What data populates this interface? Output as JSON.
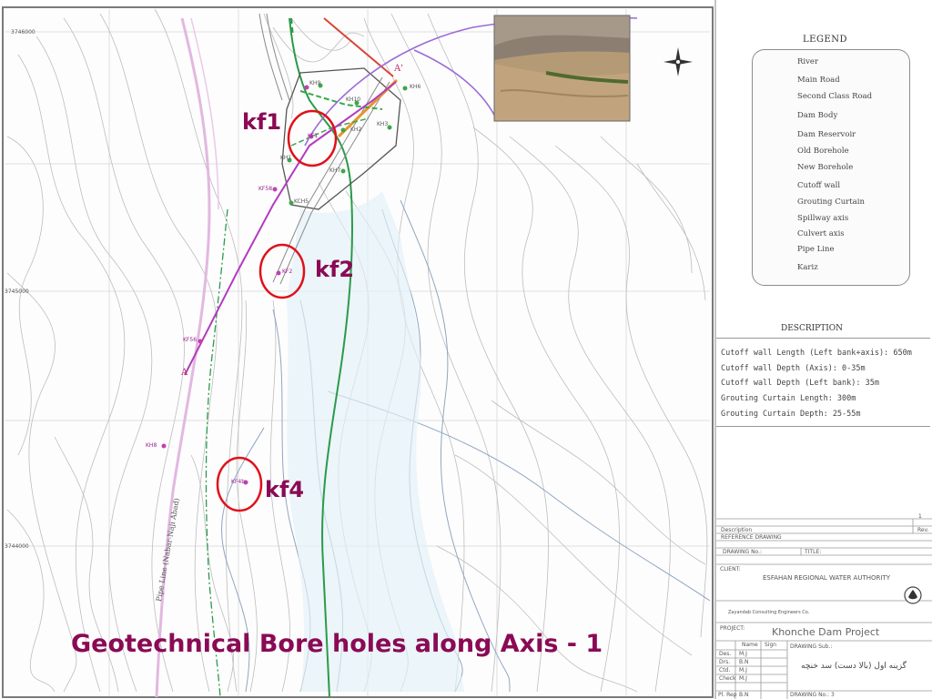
{
  "legend": {
    "title": "LEGEND",
    "items": [
      {
        "label": "River",
        "symbol": "river-line",
        "color": "#6a8fb0"
      },
      {
        "label": "Main Road",
        "symbol": "double-line",
        "color": "#888888"
      },
      {
        "label": "Second Class Road",
        "symbol": "double-line-thin",
        "color": "#aaaaaa"
      },
      {
        "label": "Dam Body",
        "symbol": "dam-outline",
        "color": "#333333"
      },
      {
        "label": "Dam Reservoir",
        "symbol": "hatched-box",
        "color": "#9cc9dd"
      },
      {
        "label": "Old Borehole",
        "symbol": "green-dot",
        "color": "#3aa84a"
      },
      {
        "label": "New Borehole",
        "symbol": "pink-dot",
        "color": "#c040b0"
      },
      {
        "label": "Cutoff wall",
        "symbol": "line",
        "color": "#b23bc0"
      },
      {
        "label": "Grouting Curtain",
        "symbol": "line",
        "color": "#e8952a"
      },
      {
        "label": "Spillway axis",
        "symbol": "line",
        "color": "#d9443a"
      },
      {
        "label": "Culvert axis",
        "symbol": "dash-line",
        "color": "#3aa84a"
      },
      {
        "label": "Pipe Line",
        "symbol": "thick-line",
        "color": "#e2b8e0"
      },
      {
        "label": "Kariz",
        "symbol": "dot-line",
        "color": "#3aa890"
      }
    ]
  },
  "description": {
    "title": "DESCRIPTION",
    "lines": [
      "Cutoff wall Length (Left bank+axis): 650m",
      "Cutoff wall Depth (Axis): 0-35m",
      "Cutoff wall Depth (Left bank): 35m",
      "Grouting Curtain Length: 300m",
      "Grouting Curtain Depth: 25-55m"
    ]
  },
  "title_block": {
    "description_label": "Description",
    "rev_label": "Rev.",
    "rev_value": "1",
    "reference_drawing": "REFERENCE DRAWING",
    "drawing_no": "DRAWING No.:",
    "title_label": "TITLE:",
    "client_label": "CLIENT:",
    "client_name": "ESFAHAN REGIONAL WATER AUTHORITY",
    "consultant": "Zayandab Consulting Engineers Co.",
    "project_label": "PROJECT:",
    "project_name": "Khonche Dam Project",
    "drawing_sub": "DRAWING Sub.:",
    "persian_title": "گزینه اول (بالا دست) سد خنچه",
    "drawing_no_value": "DRAWING No.: 3",
    "rows": [
      {
        "role": "Des.",
        "by": "M.J"
      },
      {
        "role": "Drs.",
        "by": "B.N"
      },
      {
        "role": "Ctd.",
        "by": "M.J"
      },
      {
        "role": "Check",
        "by": "M.J"
      },
      {
        "role": "Pl. Rep",
        "by": "B.N"
      }
    ],
    "name_col": "Name",
    "sign_col": "Sign"
  },
  "map": {
    "coord_labels": [
      "3746000",
      "3745000",
      "3744000"
    ],
    "axis_letters": [
      "A",
      "A'"
    ],
    "pipe_line_label": "Pipe Line (Nabar-Naji Abad)",
    "boreholes": [
      {
        "label": "KH9",
        "kind": "old"
      },
      {
        "label": "KH6",
        "kind": "old"
      },
      {
        "label": "KH10",
        "kind": "old"
      },
      {
        "label": "KH3",
        "kind": "old"
      },
      {
        "label": "KH2",
        "kind": "old"
      },
      {
        "label": "KH1",
        "kind": "old"
      },
      {
        "label": "KH7",
        "kind": "old"
      },
      {
        "label": "KF1",
        "kind": "new"
      },
      {
        "label": "KF58",
        "kind": "new"
      },
      {
        "label": "KCH5",
        "kind": "old"
      },
      {
        "label": "KF2",
        "kind": "new"
      },
      {
        "label": "KF56",
        "kind": "new"
      },
      {
        "label": "KH8",
        "kind": "new"
      },
      {
        "label": "KF4b",
        "kind": "new"
      }
    ]
  },
  "annotations": [
    {
      "label": "kf1"
    },
    {
      "label": "kf2"
    },
    {
      "label": "kf4"
    }
  ],
  "caption": "Geotechnical Bore holes along Axis - 1",
  "colors": {
    "accent": "#8a0a55",
    "circle": "#e0101a",
    "river": "#2a9a4a",
    "contour": "#b8b8b8",
    "cutoff": "#b23bc0"
  }
}
